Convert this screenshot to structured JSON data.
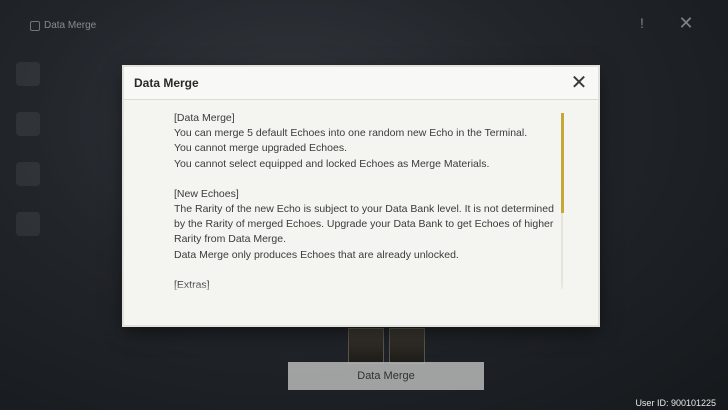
{
  "background": {
    "title": "Data Merge",
    "merge_button": "Data Merge",
    "user_id": "User ID: 900101225"
  },
  "dialog": {
    "title": "Data Merge",
    "sections": [
      {
        "heading": "[Data Merge]",
        "lines": [
          "You can merge 5 default Echoes into one random new Echo in the Terminal.",
          "You cannot merge upgraded Echoes.",
          "You cannot select equipped and locked Echoes as Merge Materials."
        ]
      },
      {
        "heading": "[New Echoes]",
        "lines": [
          "The Rarity of the new Echo is subject to your Data Bank level. It is not determined by the Rarity of merged Echoes. Upgrade your Data Bank to get Echoes of higher Rarity from Data Merge.",
          "Data Merge only produces Echoes that are already unlocked."
        ]
      },
      {
        "heading": "[Extras]",
        "lines": []
      }
    ]
  },
  "colors": {
    "accent": "#c6a83a",
    "dialog_bg": "#f4f4f1"
  }
}
